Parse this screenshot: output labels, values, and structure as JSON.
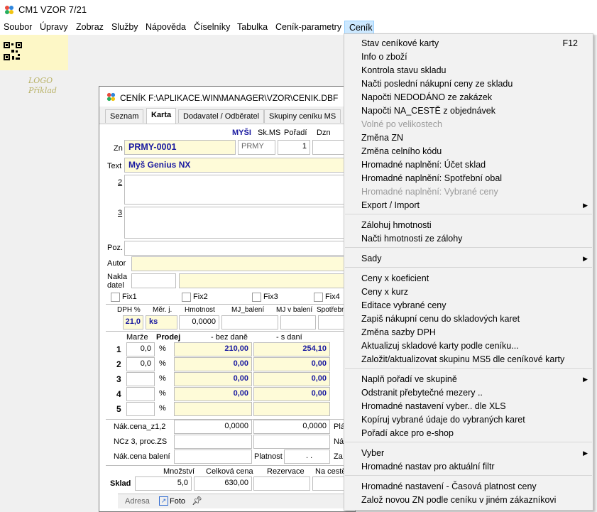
{
  "app": {
    "title": "CM1 VZOR 7/21"
  },
  "menubar": [
    "Soubor",
    "Úpravy",
    "Zobraz",
    "Služby",
    "Nápověda",
    "Číselníky",
    "Tabulka",
    "Ceník-parametry",
    "Ceník"
  ],
  "logo": {
    "line1": "LOGO",
    "line2": "Příklad"
  },
  "window": {
    "title": "CENÍK F:\\APLIKACE.WIN\\MANAGER\\VZOR\\CENIK.DBF",
    "tabs": [
      "Seznam",
      "Karta",
      "Dodavatel / Odběratel",
      "Skupiny ceníku MS"
    ],
    "header": {
      "group": "MYŠI",
      "skms": "Sk.MS",
      "poradi": "Pořadí",
      "dzn": "Dzn"
    },
    "zn_label": "Zn",
    "zn_value": "PRMY-0001",
    "skms_value": "PRMY",
    "poradi_value": "1",
    "text_label": "Text",
    "text_value": "Myš Genius NX",
    "line2_label": "2",
    "line3_label": "3",
    "poz_label": "Poz.",
    "autor_label": "Autor",
    "nakladatel_label": "Nakla\ndatel",
    "fix": [
      "Fix1",
      "Fix2",
      "Fix3",
      "Fix4"
    ],
    "cols": {
      "dph": "DPH %",
      "mj": "Měr. j.",
      "hmotnost": "Hmotnost",
      "mj_baleni": "MJ_balení",
      "mj_v_baleni": "MJ v balení",
      "spotrebni": "Spotřebn"
    },
    "dph_value": "21,0",
    "mj_value": "ks",
    "hmotnost_value": "0,0000",
    "price_headers": {
      "marze": "Marže",
      "prodej": "Prodej",
      "bez_dane": "- bez daně",
      "s_dani": "- s daní"
    },
    "price_rows": [
      {
        "n": "1",
        "marze": "0,0",
        "pct": "%",
        "bez": "210,00",
        "s": "254,10"
      },
      {
        "n": "2",
        "marze": "0,0",
        "pct": "%",
        "bez": "0,00",
        "s": "0,00"
      },
      {
        "n": "3",
        "marze": "",
        "pct": "%",
        "bez": "0,00",
        "s": "0,00"
      },
      {
        "n": "4",
        "marze": "",
        "pct": "%",
        "bez": "0,00",
        "s": "0,00"
      },
      {
        "n": "5",
        "marze": "",
        "pct": "%",
        "bez": "",
        "s": ""
      }
    ],
    "nak_cena_label": "Nák.cena_z1,2",
    "nak_cena_1": "0,0000",
    "nak_cena_2": "0,0000",
    "pla_label": "Plá",
    "ncz_label": "NCz 3, proc.ZS",
    "na_label": "Ná",
    "nak_baleni_label": "Nák.cena balení",
    "platnost_label": "Platnost",
    "platnost_value": ". .",
    "za_label": "Za",
    "sklad": {
      "label": "Sklad",
      "mnozstvi_h": "Množství",
      "celkova_h": "Celková cena",
      "rezervace_h": "Rezervace",
      "na_ceste_h": "Na cestě",
      "mnozstvi": "5,0",
      "celkova": "630,00"
    },
    "bottom_tabs": {
      "adresa": "Adresa",
      "foto": "Foto"
    }
  },
  "context_menu": {
    "items": [
      {
        "label": "Stav ceníkové karty",
        "shortcut": "F12"
      },
      {
        "label": "Info o zboží"
      },
      {
        "label": "Kontrola stavu skladu"
      },
      {
        "label": "Načti poslední nákupní ceny ze skladu"
      },
      {
        "label": "Napočti NEDODÁNO ze zakázek"
      },
      {
        "label": "Napočti NA_CESTĚ z objednávek"
      },
      {
        "label": "Volné po velikostech",
        "disabled": true
      },
      {
        "label": "Změna ZN"
      },
      {
        "label": "Změna celního kódu"
      },
      {
        "label": "Hromadné naplnění: Účet sklad"
      },
      {
        "label": "Hromadné naplnění: Spotřební obal"
      },
      {
        "label": "Hromadné naplnění: Vybrané ceny",
        "disabled": true
      },
      {
        "label": "Export / Import",
        "submenu": true
      },
      {
        "label": "Zálohuj hmotnosti"
      },
      {
        "label": "Načti hmotnosti ze zálohy"
      },
      {
        "label": "Sady",
        "submenu": true
      },
      {
        "label": "Ceny x koeficient"
      },
      {
        "label": "Ceny x kurz"
      },
      {
        "label": "Editace vybrané ceny"
      },
      {
        "label": "Zapiš nákupní cenu do skladových karet"
      },
      {
        "label": "Změna sazby DPH"
      },
      {
        "label": "Aktualizuj skladové karty podle ceníku..."
      },
      {
        "label": "Založit/aktualizovat skupinu MS5 dle ceníkové karty"
      },
      {
        "label": "Naplň pořadí ve skupině",
        "submenu": true
      },
      {
        "label": "Odstranit přebytečné mezery .."
      },
      {
        "label": "Hromadné nastavení vyber.. dle XLS"
      },
      {
        "label": "Kopíruj vybrané údaje do vybraných karet"
      },
      {
        "label": "Pořadí akce pro e-shop"
      },
      {
        "label": "Vyber",
        "submenu": true
      },
      {
        "label": "Hromadné nastav pro aktuální filtr"
      },
      {
        "label": "Hromadné nastavení - Časová platnost ceny"
      },
      {
        "label": "Založ novou ZN podle ceníku v jiném zákazníkovi"
      }
    ]
  },
  "colors": {
    "menu_highlight": "#cce8ff",
    "field_yellow": "#fefbd8",
    "value_blue": "#1a1aa0"
  }
}
